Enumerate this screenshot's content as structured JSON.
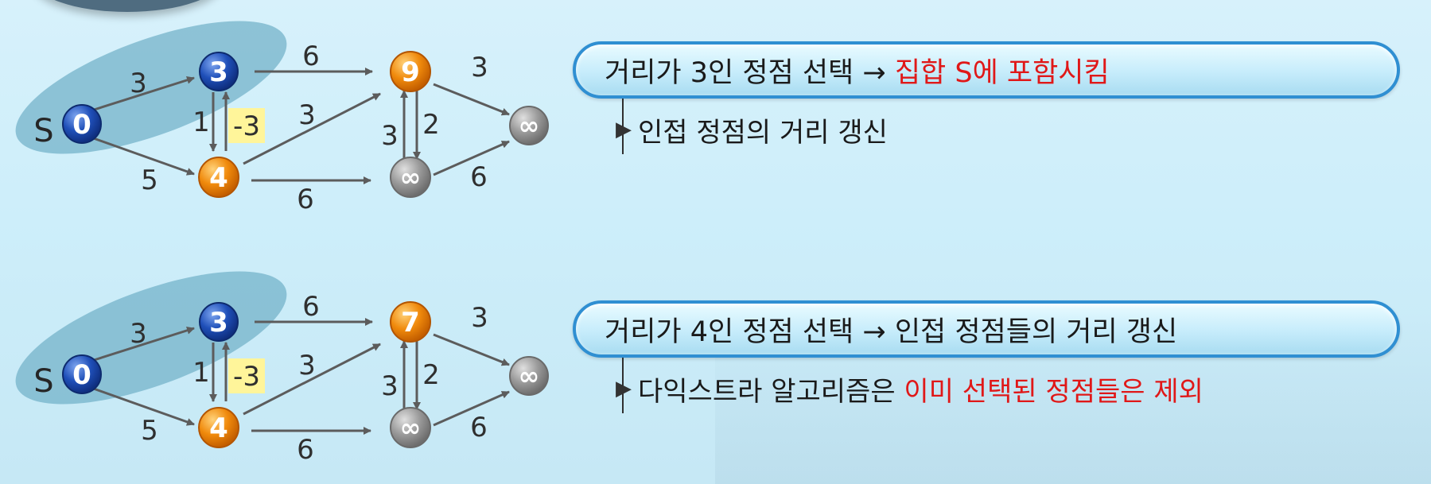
{
  "colors": {
    "selected_node": "#1b4fb8",
    "frontier_node": "#ee8a0c",
    "unvisited_node": "#9a9a9a",
    "highlight_text": "#e01818",
    "pill_border": "#2f8fd2",
    "negative_weight_bg": "#fff59a"
  },
  "graphs": [
    {
      "source_label": "S",
      "nodes": {
        "s": "0",
        "a": "3",
        "b": "4",
        "c": "9",
        "d": "∞",
        "e": "∞"
      },
      "weights": {
        "s_a": "3",
        "s_b": "5",
        "a_c": "6",
        "b_a": "1",
        "a_b": "-3",
        "b_c": "3",
        "b_d": "6",
        "d_c": "3",
        "c_d": "2",
        "c_e": "3",
        "d_e": "6"
      }
    },
    {
      "source_label": "S",
      "nodes": {
        "s": "0",
        "a": "3",
        "b": "4",
        "c": "7",
        "d": "∞",
        "e": "∞"
      },
      "weights": {
        "s_a": "3",
        "s_b": "5",
        "a_c": "6",
        "b_a": "1",
        "a_b": "-3",
        "b_c": "3",
        "b_d": "6",
        "d_c": "3",
        "c_d": "2",
        "c_e": "3",
        "d_e": "6"
      }
    }
  ],
  "steps": [
    {
      "title_plain": "거리가 3인 정점 선택 → ",
      "title_highlight": "집합 S에 포함시킴",
      "sub_plain": "인접 정점의 거리 갱신",
      "sub_highlight": ""
    },
    {
      "title_plain": "거리가 4인 정점 선택 → 인접 정점들의 거리 갱신",
      "title_highlight": "",
      "sub_plain": "다익스트라 알고리즘은 ",
      "sub_highlight": "이미 선택된 정점들은 제외"
    }
  ]
}
